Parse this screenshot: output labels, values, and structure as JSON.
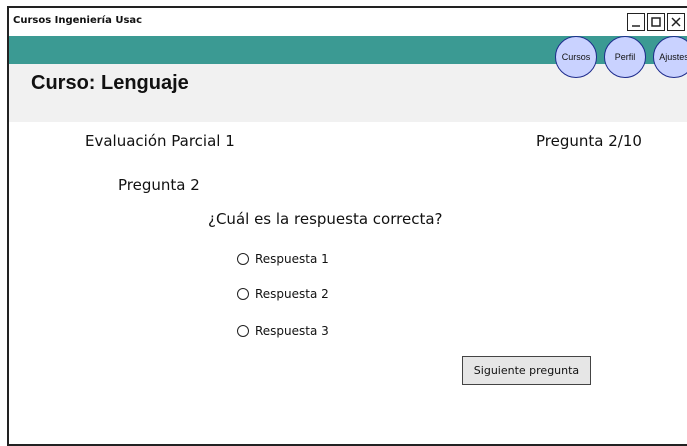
{
  "window": {
    "title": "Cursos Ingeniería Usac"
  },
  "nav": {
    "courses": "Cursos",
    "profile": "Perfil",
    "settings": "Ajustes"
  },
  "course": {
    "title": "Curso: Lenguaje"
  },
  "exam": {
    "title": "Evaluación Parcial 1",
    "counter": "Pregunta 2/10",
    "question_heading": "Pregunta 2",
    "question_text": "¿Cuál es la respuesta correcta?",
    "options": [
      {
        "label": "Respuesta 1",
        "selected": false
      },
      {
        "label": "Respuesta 2",
        "selected": false
      },
      {
        "label": "Respuesta 3",
        "selected": false
      }
    ],
    "next_label": "Siguiente pregunta"
  }
}
